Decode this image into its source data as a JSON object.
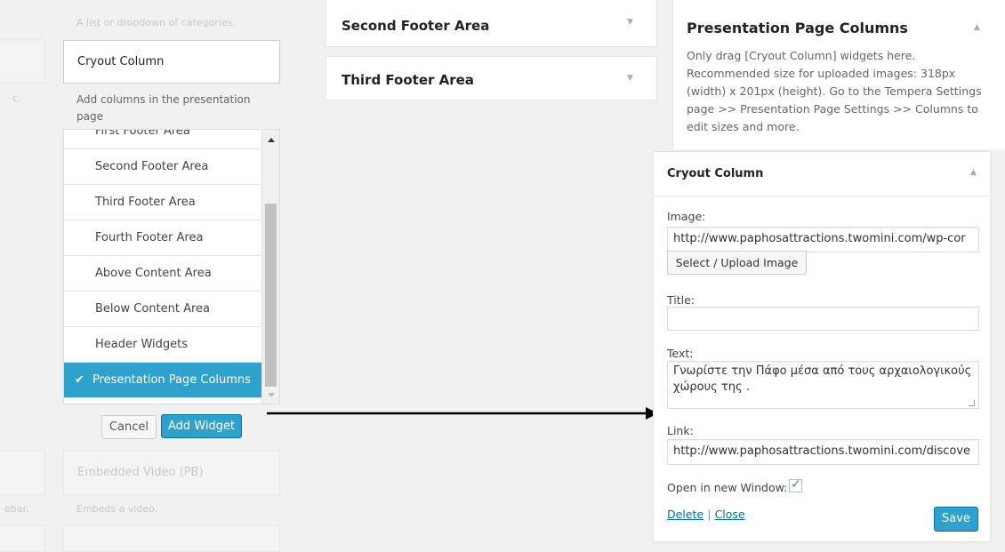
{
  "left_panel": {
    "top_faded_desc": "A list or dropdown of categories.",
    "faded_side_c": "c.",
    "faded_side_ebar": "ebar.",
    "widget_title": "Cryout Column",
    "widget_desc": "Add columns in the presentation page",
    "sidebar_items": [
      "First Footer Area",
      "Second Footer Area",
      "Third Footer Area",
      "Fourth Footer Area",
      "Above Content Area",
      "Below Content Area",
      "Header Widgets",
      "Presentation Page Columns"
    ],
    "selected_index": 7,
    "check_glyph": "✔",
    "cancel_label": "Cancel",
    "add_widget_label": "Add Widget",
    "faded_widget_title": "Embedded Video (PB)",
    "faded_widget_desc": "Embeds a video."
  },
  "middle_panel": {
    "areas": [
      {
        "title": "Second Footer Area"
      },
      {
        "title": "Third Footer Area"
      }
    ]
  },
  "right_panel": {
    "section_title": "Presentation Page Columns",
    "section_desc": "Only drag [Cryout Column] widgets here. Recommended size for uploaded images: 318px (width) x 201px (height). Go to the Tempera Settings page >> Presentation Page Settings >> Columns to edit sizes and more.",
    "widget_title": "Cryout Column",
    "image_label": "Image:",
    "image_value": "http://www.paphosattractions.twomini.com/wp-cor",
    "upload_button_label": "Select / Upload Image",
    "title_label": "Title:",
    "title_value": "",
    "text_label": "Text:",
    "text_value": "Γνωρίστε την Πάφο μέσα από τους αρχαιολογικούς χώρους της .",
    "link_label": "Link:",
    "link_value": "http://www.paphosattractions.twomini.com/discove",
    "new_window_label": "Open in new Window:",
    "new_window_checked": true,
    "delete_label": "Delete",
    "separator": "|",
    "close_label": "Close",
    "save_label": "Save"
  },
  "colors": {
    "accent": "#2ea2cc",
    "link": "#0074a2",
    "background": "#f1f1f1"
  }
}
